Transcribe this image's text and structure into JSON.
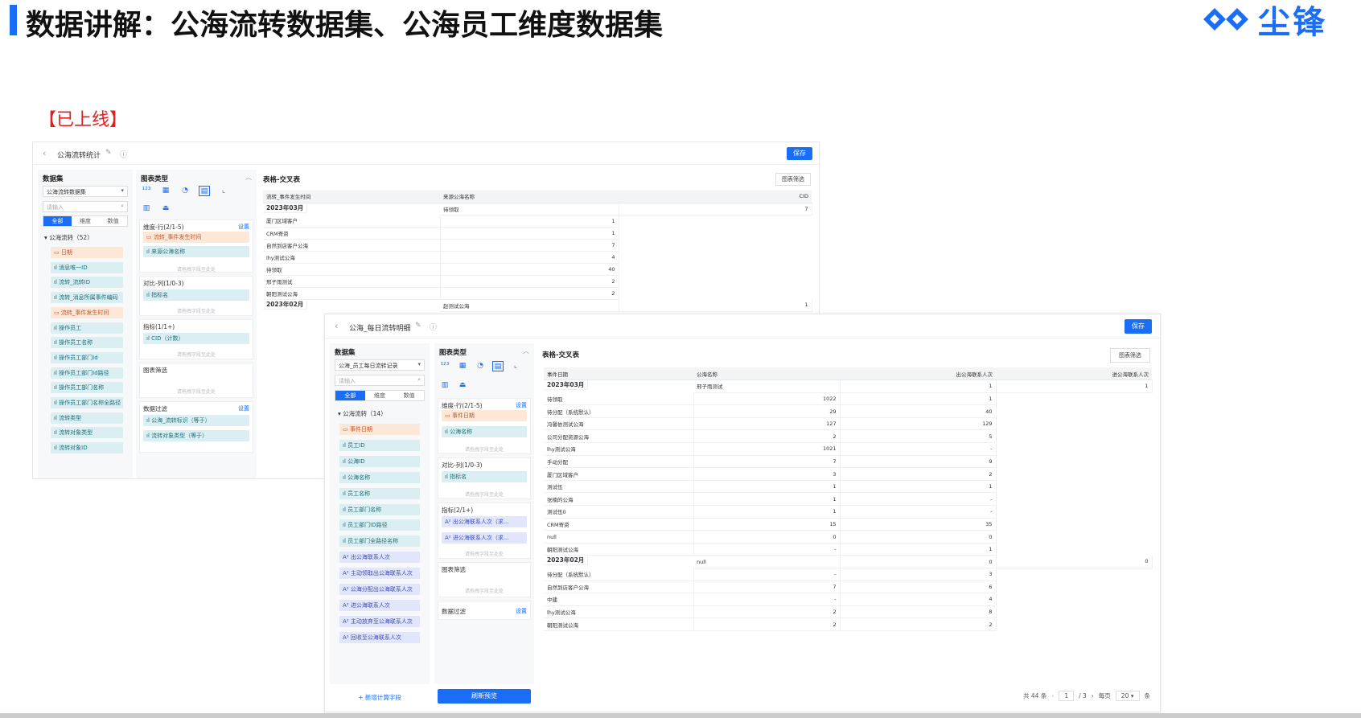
{
  "slide": {
    "title": "数据讲解：公海流转数据集、公海员工维度数据集",
    "logo_text": "尘锋",
    "tag": "【已上线】"
  },
  "colors": {
    "accent": "#1a6ef5",
    "tag_red": "#e02020"
  },
  "win1": {
    "report_name": "公海流转统计",
    "save": "保存",
    "dataset_title": "数据集",
    "dataset_value": "公海流转数据集",
    "search_placeholder": "请输入",
    "tabs": [
      "全部",
      "维度",
      "数值"
    ],
    "group": "公海流转（52）",
    "fields": [
      {
        "label": "日期",
        "kind": "date"
      },
      {
        "label": "消息唯一ID",
        "kind": "dim"
      },
      {
        "label": "流转_流转ID",
        "kind": "dim"
      },
      {
        "label": "流转_消息所属事件编码",
        "kind": "dim"
      },
      {
        "label": "流转_事件发生时间",
        "kind": "date"
      },
      {
        "label": "操作员工",
        "kind": "dim"
      },
      {
        "label": "操作员工名称",
        "kind": "dim"
      },
      {
        "label": "操作员工部门Id",
        "kind": "dim"
      },
      {
        "label": "操作员工部门Id路径",
        "kind": "dim"
      },
      {
        "label": "操作员工部门名称",
        "kind": "dim"
      },
      {
        "label": "操作员工部门名称全路径",
        "kind": "dim"
      },
      {
        "label": "流转类型",
        "kind": "dim"
      },
      {
        "label": "流转对象类型",
        "kind": "dim"
      },
      {
        "label": "流转对象ID",
        "kind": "dim"
      }
    ],
    "chart_type_title": "图表类型",
    "dim_row_title": "维度-行(2/1-5)",
    "dim_row_set": "设置",
    "dim_row_items": [
      {
        "label": "流转_事件发生时间",
        "kind": "date"
      },
      {
        "label": "来源公海名称",
        "kind": "dim"
      }
    ],
    "drop_hint": "请拖拽字段至此处",
    "compare_title": "对比-列(1/0-3)",
    "compare_items": [
      {
        "label": "指标名",
        "kind": "dim"
      }
    ],
    "metric_title": "指标(1/1+)",
    "metric_items": [
      {
        "label": "CID（计数）",
        "kind": "dim"
      }
    ],
    "chart_filter_title": "图表筛选",
    "data_filter_title": "数据过滤",
    "data_filter_set": "设置",
    "data_filter_items": [
      {
        "label": "公海_流转标识（等于）",
        "kind": "dim"
      },
      {
        "label": "流转对象类型（等于）",
        "kind": "dim"
      }
    ],
    "table_title": "表格-交叉表",
    "chart_filter_btn": "图表筛选",
    "headers": [
      "流转_事件发生时间",
      "来源公海名称",
      "CID"
    ],
    "groups": [
      {
        "date": "2023年03月",
        "rows": [
          [
            "待领取",
            "7"
          ],
          [
            "厦门区域客户",
            "1"
          ],
          [
            "CRM寄资",
            "1"
          ],
          [
            "自然到店客户公海",
            "7"
          ],
          [
            "lhy测试公海",
            "4"
          ],
          [
            "待领取",
            "40"
          ],
          [
            "邢子雨测试",
            "2"
          ],
          [
            "朝阳测试公海",
            "2"
          ]
        ]
      },
      {
        "date": "2023年02月",
        "rows": [
          [
            "赵测试公海",
            "1"
          ]
        ]
      }
    ]
  },
  "win2": {
    "report_name": "公海_每日流转明细",
    "save": "保存",
    "dataset_title": "数据集",
    "dataset_value": "公海_员工每日流转记录",
    "search_placeholder": "请输入",
    "tabs": [
      "全部",
      "维度",
      "数值"
    ],
    "group": "公海流转（14）",
    "fields": [
      {
        "label": "事件日期",
        "kind": "date"
      },
      {
        "label": "员工ID",
        "kind": "dim"
      },
      {
        "label": "公海ID",
        "kind": "dim"
      },
      {
        "label": "公海名称",
        "kind": "dim"
      },
      {
        "label": "员工名称",
        "kind": "dim"
      },
      {
        "label": "员工部门名称",
        "kind": "dim"
      },
      {
        "label": "员工部门ID路径",
        "kind": "dim"
      },
      {
        "label": "员工部门全路径名称",
        "kind": "dim"
      },
      {
        "label": "出公海联系人次",
        "kind": "calc"
      },
      {
        "label": "主动领取出公海联系人次",
        "kind": "calc"
      },
      {
        "label": "公海分配出公海联系人次",
        "kind": "calc"
      },
      {
        "label": "进公海联系人次",
        "kind": "calc"
      },
      {
        "label": "主动放弃至公海联系人次",
        "kind": "calc"
      },
      {
        "label": "回收至公海联系人次",
        "kind": "calc"
      }
    ],
    "add_calc": "+ 新增计算字段",
    "chart_type_title": "图表类型",
    "dim_row_title": "维度-行(2/1-5)",
    "dim_row_set": "设置",
    "dim_row_items": [
      {
        "label": "事件日期",
        "kind": "date"
      },
      {
        "label": "公海名称",
        "kind": "dim"
      }
    ],
    "drop_hint": "请拖拽字段至此处",
    "compare_title": "对比-列(1/0-3)",
    "compare_items": [
      {
        "label": "指标名",
        "kind": "dim"
      }
    ],
    "metric_title": "指标(2/1+)",
    "metric_items": [
      {
        "label": "出公海联系人次（求...",
        "kind": "calc"
      },
      {
        "label": "进公海联系人次（求...",
        "kind": "calc"
      }
    ],
    "chart_filter_title": "图表筛选",
    "data_filter_title": "数据过滤",
    "data_filter_set": "设置",
    "refresh": "刷新预览",
    "table_title": "表格-交叉表",
    "chart_filter_btn": "图表筛选",
    "headers": [
      "事件日期",
      "公海名称",
      "出公海联系人次",
      "进公海联系人次"
    ],
    "groups": [
      {
        "date": "2023年03月",
        "rows": [
          [
            "邢子雨测试",
            "1",
            "1"
          ],
          [
            "待领取",
            "1022",
            "1"
          ],
          [
            "待分配（系统默认）",
            "29",
            "40"
          ],
          [
            "冯馨依测试公海",
            "127",
            "129"
          ],
          [
            "公司分配资源公海",
            "2",
            "5"
          ],
          [
            "lhy测试公海",
            "1021",
            "-"
          ],
          [
            "手动分配",
            "7",
            "9"
          ],
          [
            "厦门区域客户",
            "3",
            "2"
          ],
          [
            "测试伍",
            "1",
            "1"
          ],
          [
            "张楠的公海",
            "1",
            "-"
          ],
          [
            "测试伍0",
            "1",
            "-"
          ],
          [
            "CRM寄资",
            "15",
            "35"
          ],
          [
            "null",
            "0",
            "0"
          ],
          [
            "朝阳测试公海",
            "-",
            "1"
          ]
        ]
      },
      {
        "date": "2023年02月",
        "rows": [
          [
            "null",
            "0",
            "0"
          ],
          [
            "待分配（系统默认）",
            "-",
            "3"
          ],
          [
            "自然到店客户公海",
            "7",
            "6"
          ],
          [
            "中建",
            "-",
            "4"
          ],
          [
            "lhy测试公海",
            "2",
            "8"
          ],
          [
            "朝阳测试公海",
            "2",
            "2"
          ]
        ]
      }
    ],
    "pager": {
      "total": "共 44 条",
      "page": "1",
      "pages": "/ 3",
      "per_page_label": "每页",
      "per_page": "20 ▾",
      "unit": "条"
    }
  }
}
